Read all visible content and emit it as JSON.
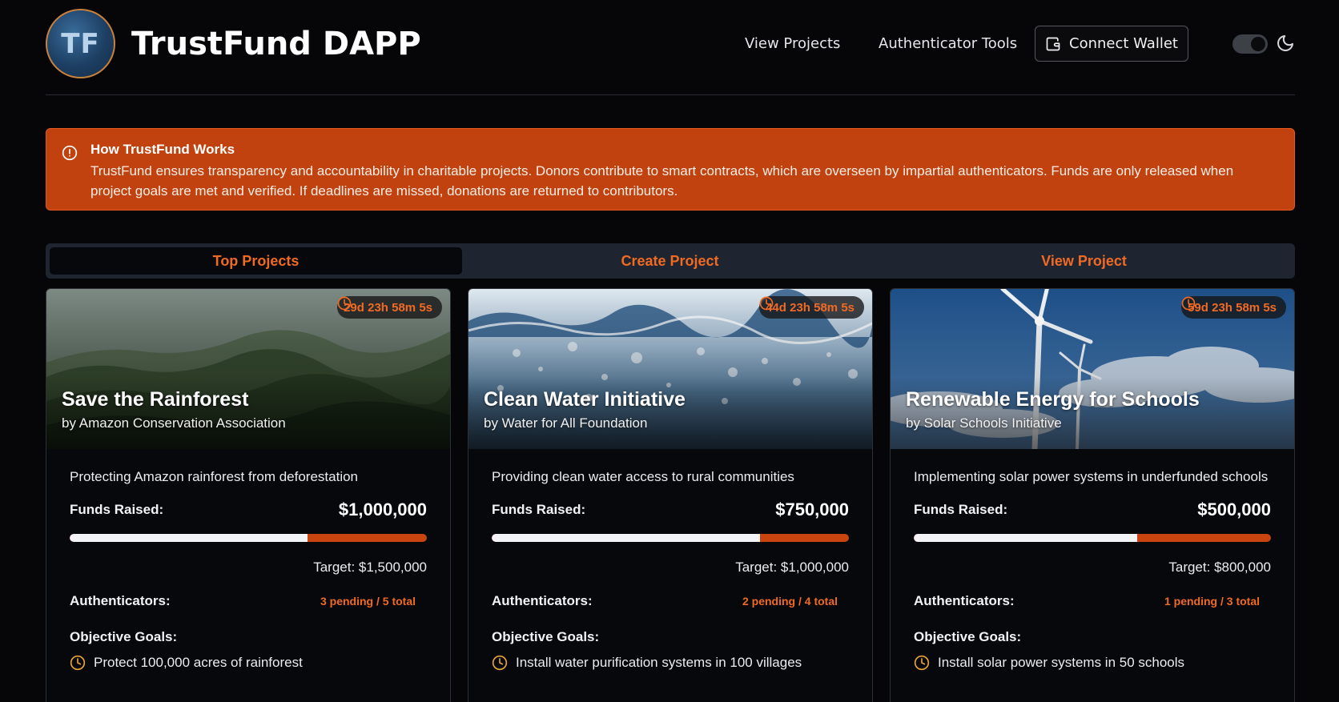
{
  "header": {
    "logo_text": "TF",
    "brand": "TrustFund DAPP",
    "nav": [
      "View Projects",
      "Authenticator Tools"
    ],
    "connect_wallet": "Connect Wallet",
    "icons": {
      "wallet": "wallet-icon",
      "theme": "moon-icon",
      "toggle": "dark-mode-toggle"
    }
  },
  "info": {
    "title": "How TrustFund Works",
    "text": "TrustFund ensures transparency and accountability in charitable projects. Donors contribute to smart contracts, which are overseen by impartial authenticators. Funds are only released when project goals are met and verified. If deadlines are missed, donations are returned to contributors.",
    "icon": "info-circle-icon"
  },
  "tabs": [
    "Top Projects",
    "Create Project",
    "View Project"
  ],
  "active_tab": "Top Projects",
  "colors": {
    "accent": "#f06a24",
    "banner": "#c1420f",
    "background": "#060608"
  },
  "projects": [
    {
      "timer": "29d 23h 58m 5s",
      "title": "Save the Rainforest",
      "org": "by Amazon Conservation Association",
      "description": "Protecting Amazon rainforest from deforestation",
      "funds_label": "Funds Raised:",
      "funds": "$1,000,000",
      "progress": 0.667,
      "target": "Target: $1,500,000",
      "auth_label": "Authenticators:",
      "authenticators": "3 pending / 5 total",
      "goals_title": "Objective Goals:",
      "goals": [
        "Protect 100,000 acres of rainforest"
      ],
      "image": "rainforest"
    },
    {
      "timer": "44d 23h 58m 5s",
      "title": "Clean Water Initiative",
      "org": "by Water for All Foundation",
      "description": "Providing clean water access to rural communities",
      "funds_label": "Funds Raised:",
      "funds": "$750,000",
      "progress": 0.75,
      "target": "Target: $1,000,000",
      "auth_label": "Authenticators:",
      "authenticators": "2 pending / 4 total",
      "goals_title": "Objective Goals:",
      "goals": [
        "Install water purification systems in 100 villages"
      ],
      "image": "water"
    },
    {
      "timer": "59d 23h 58m 5s",
      "title": "Renewable Energy for Schools",
      "org": "by Solar Schools Initiative",
      "description": "Implementing solar power systems in underfunded schools",
      "funds_label": "Funds Raised:",
      "funds": "$500,000",
      "progress": 0.625,
      "target": "Target: $800,000",
      "auth_label": "Authenticators:",
      "authenticators": "1 pending / 3 total",
      "goals_title": "Objective Goals:",
      "goals": [
        "Install solar power systems in 50 schools"
      ],
      "image": "wind"
    }
  ]
}
